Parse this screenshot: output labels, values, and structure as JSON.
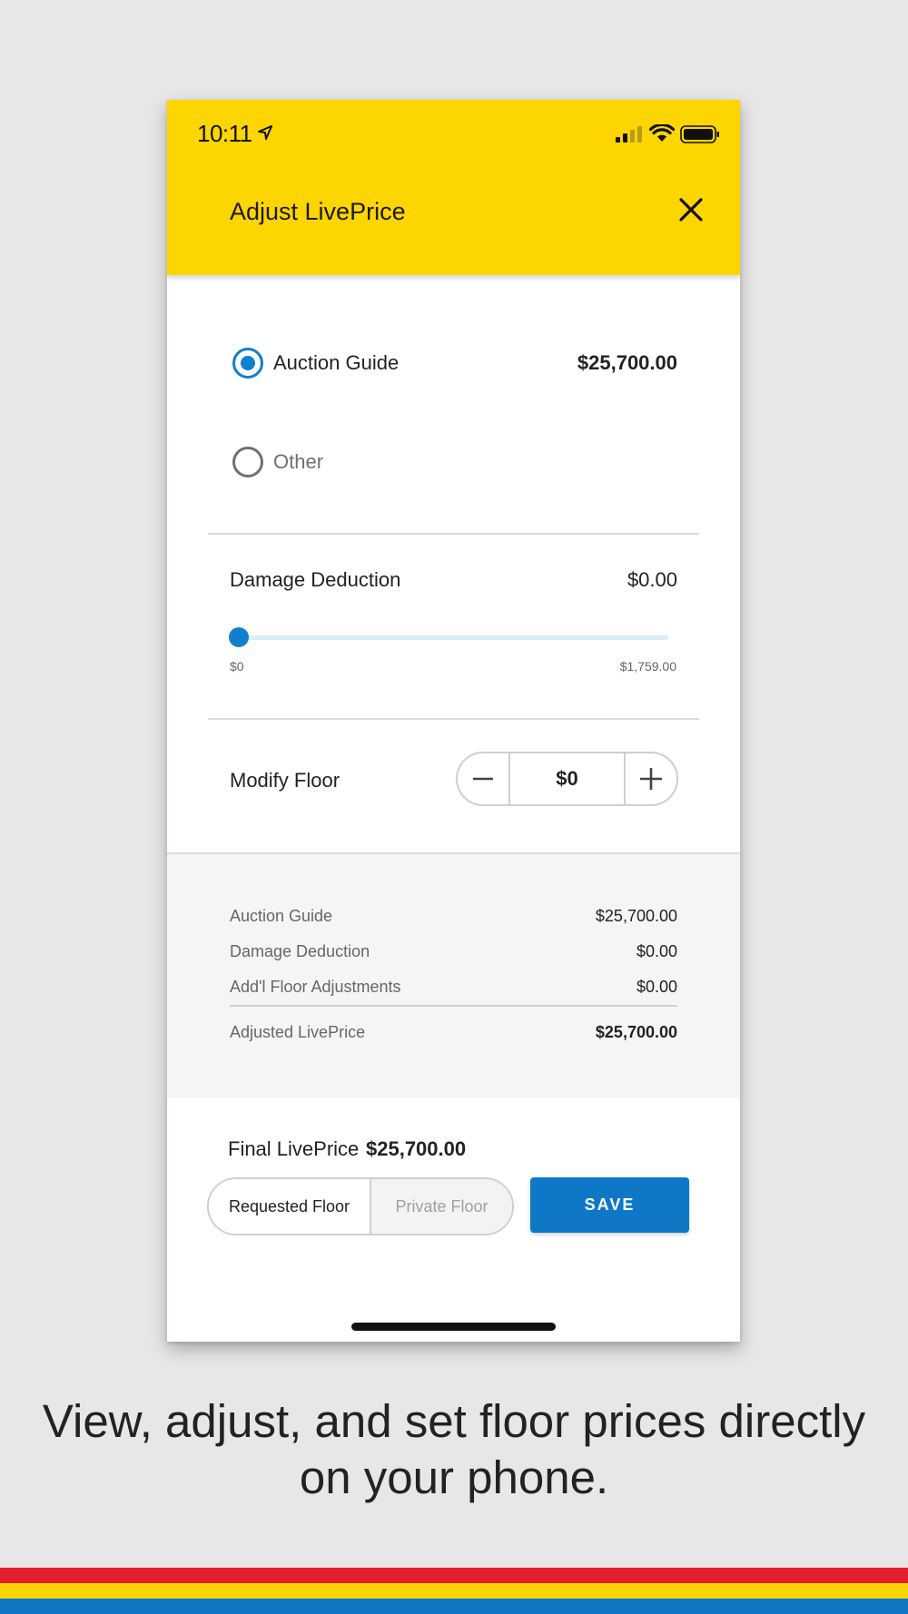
{
  "status_bar": {
    "time": "10:11"
  },
  "header": {
    "title": "Adjust LivePrice"
  },
  "price_options": [
    {
      "label": "Auction Guide",
      "amount": "$25,700.00",
      "selected": true
    },
    {
      "label": "Other",
      "amount": "",
      "selected": false
    }
  ],
  "damage": {
    "label": "Damage Deduction",
    "value": "$0.00",
    "slider_min_label": "$0",
    "slider_max_label": "$1,759.00",
    "slider_fraction": 0
  },
  "modify_floor": {
    "label": "Modify Floor",
    "value": "$0"
  },
  "summary": {
    "rows": [
      {
        "label": "Auction Guide",
        "value": "$25,700.00"
      },
      {
        "label": "Damage Deduction",
        "value": "$0.00"
      },
      {
        "label": "Add'l Floor Adjustments",
        "value": "$0.00"
      }
    ],
    "total": {
      "label": "Adjusted LivePrice",
      "value": "$25,700.00"
    }
  },
  "final": {
    "label": "Final LivePrice",
    "value": "$25,700.00"
  },
  "floor_toggle": {
    "options": [
      "Requested Floor",
      "Private Floor"
    ],
    "selected": "Requested Floor"
  },
  "save_label": "SAVE",
  "caption": "View, adjust, and set floor prices directly on your phone.",
  "colors": {
    "header": "#FDD500",
    "accent": "#0E78C6",
    "stripe_red": "#E31F2B",
    "stripe_yellow": "#FDD500",
    "stripe_blue": "#0E78C6"
  },
  "icons": [
    "location-arrow-icon",
    "signal-icon",
    "wifi-icon",
    "battery-icon",
    "close-icon",
    "minus-icon",
    "plus-icon"
  ]
}
